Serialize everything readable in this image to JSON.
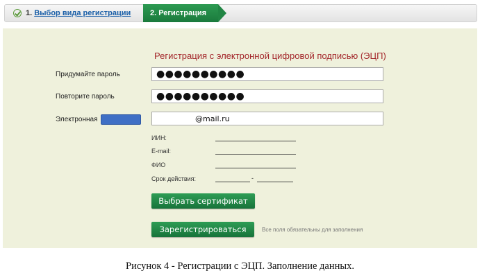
{
  "steps": {
    "step1_number": "1.",
    "step1_label": "Выбор вида регистрации",
    "step2_label": "2. Регистрация"
  },
  "form": {
    "title": "Регистрация с электронной цифровой подписью (ЭЦП)",
    "password_label": "Придумайте пароль",
    "password_value": "●●●●●●●●●●",
    "repeat_label": "Повторите пароль",
    "repeat_value": "●●●●●●●●●●",
    "email_label": "Электронная",
    "email_value": "@mail.ru"
  },
  "certificate": {
    "iin_label": "ИИН:",
    "email_label": "E-mail:",
    "fio_label": "ФИО",
    "validity_label": "Срок действия:",
    "validity_separator": "-"
  },
  "buttons": {
    "choose_cert": "Выбрать сертификат",
    "register": "Зарегистрироваться"
  },
  "hint": "Все поля обязательны для заполнения",
  "caption": "Рисунок 4 - Регистрации с ЭЦП. Заполнение данных.",
  "colors": {
    "accent_green": "#1f8544",
    "title_red": "#a3262a",
    "panel_bg": "#eff1dc",
    "link_blue": "#1a5fa8"
  }
}
